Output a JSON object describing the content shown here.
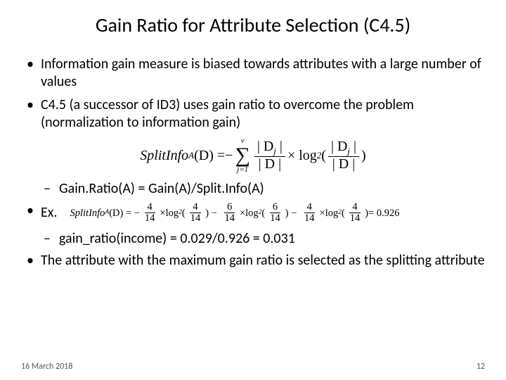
{
  "title": "Gain Ratio for Attribute Selection (C4.5)",
  "bullets": {
    "b1": "Information gain measure is biased towards attributes with a large number of values",
    "b2": "C4.5 (a successor of ID3) uses gain ratio to overcome the problem (normalization to information gain)",
    "b3_sub": "Gain.Ratio(A) = Gain(A)/Split.Info(A)",
    "b4": "Ex.",
    "b4_sub": "gain_ratio(income) = 0.029/0.926 = 0.031",
    "b5": "The attribute with the maximum gain ratio is selected as the splitting attribute"
  },
  "formula1": {
    "lhs": "SplitInfo",
    "lhs_sub": "A",
    "arg": "(D) = ",
    "neg": "−",
    "sum_top": "v",
    "sum_bot": "j=1",
    "frac_n": "| D",
    "frac_n_sub": "j",
    "frac_n_end": " |",
    "frac_d": "| D |",
    "times": "×",
    "log": "log",
    "log_base": "2",
    "lp": "(",
    "rp": ")"
  },
  "formula2": {
    "lhs": "SplitInfo",
    "lhs_sub": "A",
    "arg": "(D) = −",
    "n1": "4",
    "d": "14",
    "n2": "6",
    "n3": "4",
    "eq_result": " = 0.926"
  },
  "footer": {
    "date": "16 March 2018",
    "page": "12"
  }
}
